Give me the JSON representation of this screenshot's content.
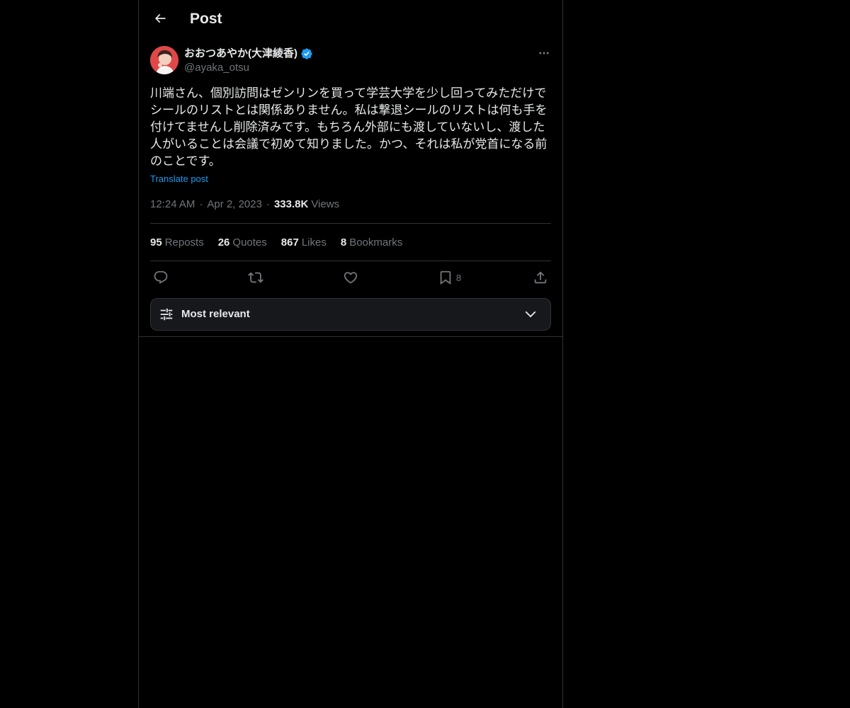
{
  "header": {
    "title": "Post"
  },
  "author": {
    "display_name": "おおつあやか(大津綾香)",
    "handle": "@ayaka_otsu",
    "verified": true
  },
  "post": {
    "text": "川端さん、個別訪問はゼンリンを買って学芸大学を少し回ってみただけでシールのリストとは関係ありません。私は撃退シールのリストは何も手を付けてませんし削除済みです。もちろん外部にも渡していないし、渡した人がいることは会議で初めて知りました。かつ、それは私が党首になる前のことです。",
    "translate_label": "Translate post",
    "time": "12:24 AM",
    "date": "Apr 2, 2023",
    "views_count": "333.8K",
    "views_label": "Views"
  },
  "stats": {
    "reposts_count": "95",
    "reposts_label": "Reposts",
    "quotes_count": "26",
    "quotes_label": "Quotes",
    "likes_count": "867",
    "likes_label": "Likes",
    "bookmarks_count": "8",
    "bookmarks_label": "Bookmarks"
  },
  "actions": {
    "bookmark_count": "8"
  },
  "sort": {
    "label": "Most relevant"
  },
  "colors": {
    "background": "#000000",
    "text": "#e7e9ea",
    "secondary": "#71767b",
    "accent": "#1d9bf0",
    "border": "#2f3336"
  },
  "icons": {
    "back": "arrow-left-icon",
    "verified": "verified-badge-icon",
    "more": "more-dots-icon",
    "reply": "reply-icon",
    "repost": "repost-icon",
    "like": "heart-icon",
    "bookmark": "bookmark-icon",
    "share": "share-icon",
    "sort": "sliders-icon",
    "chevron": "chevron-down-icon"
  }
}
